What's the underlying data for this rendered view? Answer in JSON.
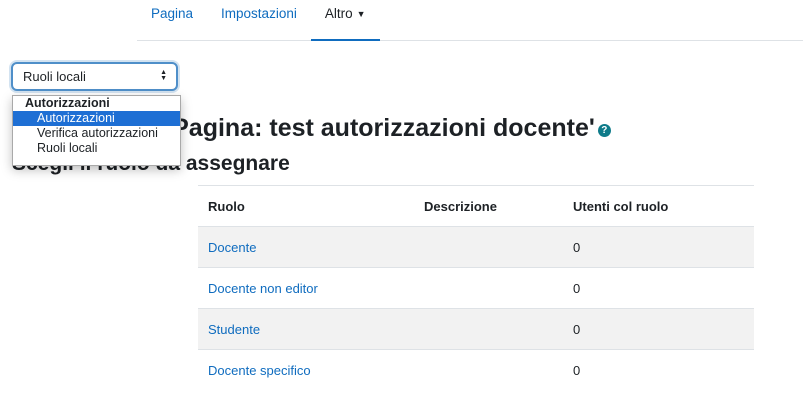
{
  "nav": {
    "tabs": [
      {
        "label": "Pagina"
      },
      {
        "label": "Impostazioni"
      },
      {
        "label": "Altro"
      }
    ]
  },
  "select": {
    "value": "Ruoli locali",
    "group_label": "Autorizzazioni",
    "options": [
      "Autorizzazioni",
      "Verifica autorizzazioni",
      "Ruoli locali"
    ],
    "highlighted": "Autorizzazioni"
  },
  "page": {
    "heading": "nel contesto 'Pagina: test autorizzazioni docente'",
    "subheading": "Scegli il ruolo da assegnare",
    "help_icon": "question-circle-icon"
  },
  "table": {
    "headers": [
      "Ruolo",
      "Descrizione",
      "Utenti col ruolo"
    ],
    "rows": [
      {
        "role": "Docente",
        "description": "",
        "users": "0"
      },
      {
        "role": "Docente non editor",
        "description": "",
        "users": "0"
      },
      {
        "role": "Studente",
        "description": "",
        "users": "0"
      },
      {
        "role": "Docente specifico",
        "description": "",
        "users": "0"
      }
    ]
  },
  "colors": {
    "link": "#0f6cbf",
    "selected_option": "#1e6fd4",
    "help_icon": "#0e7b8a"
  }
}
